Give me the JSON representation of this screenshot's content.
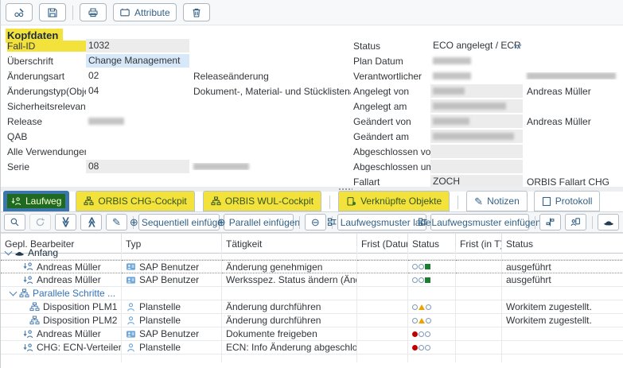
{
  "top_toolbar": {
    "attribute_label": "Attribute",
    "icons": [
      "display-change-icon",
      "save-icon",
      "print-icon",
      "attribute-icon",
      "delete-icon"
    ]
  },
  "header": {
    "section_title": "Kopfdaten"
  },
  "form": {
    "left": [
      {
        "label": "Fall-ID",
        "value": "1032",
        "desc": ""
      },
      {
        "label": "Überschrift",
        "value": "Change Management",
        "desc": ""
      },
      {
        "label": "Änderungsart",
        "value": "02",
        "desc": "Releaseänderung"
      },
      {
        "label": "Änderungstyp(Objekt)",
        "value": "04",
        "desc": "Dokument-, Material- und Stücklistenänderung"
      },
      {
        "label": "Sicherheitsrelevant",
        "value": "",
        "desc": ""
      },
      {
        "label": "Release",
        "value": "",
        "desc": ""
      },
      {
        "label": "QAB",
        "value": "",
        "desc": ""
      },
      {
        "label": "Alle Verwendungen",
        "value": "",
        "desc": ""
      },
      {
        "label": "Serie",
        "value": "08",
        "desc": ""
      }
    ],
    "right": [
      {
        "label": "Status",
        "value": "ECO angelegt / ECR genel",
        "desc": ""
      },
      {
        "label": "Plan Datum",
        "value": "",
        "desc": ""
      },
      {
        "label": "Verantwortlicher",
        "value": "",
        "desc": ""
      },
      {
        "label": "Angelegt von",
        "value": "",
        "desc": "Andreas Müller"
      },
      {
        "label": "Angelegt am",
        "value": "",
        "desc": ""
      },
      {
        "label": "Geändert von",
        "value": "",
        "desc": "Andreas Müller"
      },
      {
        "label": "Geändert am",
        "value": "",
        "desc": ""
      },
      {
        "label": "Abgeschlossen von",
        "value": "",
        "desc": ""
      },
      {
        "label": "Abgeschlossen um",
        "value": "",
        "desc": ""
      },
      {
        "label": "Fallart",
        "value": "ZOCH",
        "desc": "ORBIS Fallart CHG"
      }
    ]
  },
  "tabs": [
    {
      "label": "Laufweg",
      "icon": "workflow-step-icon",
      "active": true,
      "highlight": "green"
    },
    {
      "label": "ORBIS CHG-Cockpit",
      "icon": "cockpit-icon",
      "highlight": "yellow"
    },
    {
      "label": "ORBIS WUL-Cockpit",
      "icon": "cockpit-icon",
      "highlight": "yellow"
    },
    {
      "label": "Verknüpfte Objekte",
      "icon": "linked-objects-icon",
      "highlight": "yellow"
    },
    {
      "label": "Notizen",
      "icon": "pen-icon",
      "highlight": "none"
    },
    {
      "label": "Protokoll",
      "icon": "document-icon",
      "highlight": "none"
    }
  ],
  "table_toolbar": {
    "buttons": {
      "sequential_insert": "Sequentiell einfügen",
      "parallel_insert": "Parallel einfügen",
      "pattern_load": "Laufwegsmuster laden",
      "pattern_insert": "Laufwegsmuster einfügen"
    },
    "glyphs": {
      "plus": "⊕",
      "minus": "⊖",
      "chevrons": "≫",
      "pen": "✎"
    },
    "icons": [
      "search-icon",
      "refresh-icon",
      "expand-all-icon",
      "collapse-all-icon",
      "pen-icon",
      "plus-circle-icon",
      "minus-circle-icon",
      "pattern-icon",
      "distribute-icon",
      "agent-icon",
      "start-hat-icon"
    ]
  },
  "table": {
    "columns": [
      "Gepl. Bearbeiter",
      "Typ",
      "Tätigkeit",
      "Frist (Datum)",
      "Status",
      "Frist (in T)",
      "Status"
    ],
    "rows": [
      {
        "name": "Anfang",
        "icon": "start-hat-icon",
        "group": true,
        "typ": "",
        "activity": "",
        "frist_datum": "",
        "frist_t": "",
        "status": "",
        "lights": []
      },
      {
        "name": "Andreas Müller",
        "icon": "workflow-step-icon",
        "typ": "SAP Benutzer",
        "typ_icon": "sap-user-icon",
        "activity": "Änderung genehmigen",
        "frist_datum": "",
        "frist_t": "",
        "status": "ausgeführt",
        "lights": [
          "light circle-outline",
          "light circle-outline",
          "light green-square"
        ]
      },
      {
        "name": "Andreas Müller",
        "icon": "workflow-step-icon",
        "typ": "SAP Benutzer",
        "typ_icon": "sap-user-icon",
        "activity": "Werksspez. Status ändern (Änderung)",
        "frist_datum": "",
        "frist_t": "",
        "status": "ausgeführt",
        "lights": [
          "light circle-outline",
          "light circle-outline",
          "light green-square"
        ]
      },
      {
        "name": "Parallele Schritte ...",
        "icon": "parallel-steps-icon",
        "group": true,
        "typ": "",
        "activity": "",
        "frist_datum": "",
        "frist_t": "",
        "status": "",
        "lights": []
      },
      {
        "name": "Disposition PLM1",
        "icon": "parallel-steps-icon",
        "typ": "Planstelle",
        "typ_icon": "person-icon",
        "activity": "Änderung durchführen",
        "frist_datum": "",
        "frist_t": "",
        "status": "Workitem zugestellt.",
        "lights": [
          "light circle-outline",
          "light orange-triangle",
          "light circle-outline"
        ]
      },
      {
        "name": "Disposition PLM2",
        "icon": "parallel-steps-icon",
        "typ": "Planstelle",
        "typ_icon": "person-icon",
        "activity": "Änderung durchführen",
        "frist_datum": "",
        "frist_t": "",
        "status": "Workitem zugestellt.",
        "lights": [
          "light circle-outline",
          "light orange-triangle",
          "light circle-outline"
        ]
      },
      {
        "name": "Andreas Müller",
        "icon": "workflow-step-icon",
        "typ": "SAP Benutzer",
        "typ_icon": "sap-user-icon",
        "activity": "Dokumente freigeben",
        "frist_datum": "",
        "frist_t": "",
        "status": "",
        "lights": [
          "light red-dot",
          "light circle-outline",
          "light circle-outline"
        ]
      },
      {
        "name": "CHG: ECN-Verteiler",
        "icon": "workflow-step-icon",
        "typ": "Planstelle",
        "typ_icon": "person-icon",
        "activity": "ECN: Info Änderung abgeschlossen",
        "frist_datum": "",
        "frist_t": "",
        "status": "",
        "lights": [
          "light red-dot",
          "light circle-outline",
          "light circle-outline"
        ]
      }
    ]
  }
}
